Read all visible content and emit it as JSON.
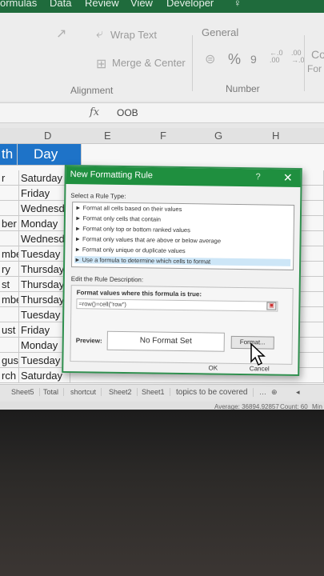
{
  "menubar": {
    "items": [
      "ormulas",
      "Data",
      "Review",
      "View",
      "Developer"
    ]
  },
  "ribbon": {
    "wrap_text": "Wrap Text",
    "merge_center": "Merge & Center",
    "number_format": "General",
    "percent": "%",
    "comma": "9",
    "inc_decimal": "←.0 .00",
    "dec_decimal": ".00 →.0",
    "conditional": "Co",
    "format_label": "For",
    "alignment_label": "Alignment",
    "number_label": "Number"
  },
  "formula_bar": {
    "fx": "fx",
    "value": "OOB"
  },
  "columns": [
    "D",
    "E",
    "F",
    "G",
    "H"
  ],
  "grid": {
    "header": [
      "th",
      "Day"
    ],
    "rows": [
      [
        "r",
        "Saturday"
      ],
      [
        "",
        "Friday"
      ],
      [
        "",
        "Wednesd"
      ],
      [
        "ber",
        "Monday"
      ],
      [
        "",
        "Wednesd"
      ],
      [
        "mber",
        "Tuesday"
      ],
      [
        "ry",
        "Thursday"
      ],
      [
        "st",
        "Thursday"
      ],
      [
        "mber",
        "Thursday"
      ],
      [
        "",
        "Tuesday"
      ],
      [
        "ust",
        "Friday"
      ],
      [
        "",
        "Monday"
      ],
      [
        "gust",
        "Tuesday"
      ],
      [
        "rch",
        "Saturday"
      ]
    ]
  },
  "dialog": {
    "title": "New Formatting Rule",
    "help": "?",
    "close": "✕",
    "select_label": "Select a Rule Type:",
    "rule_types": [
      "► Format all cells based on their values",
      "► Format only cells that contain",
      "► Format only top or bottom ranked values",
      "► Format only values that are above or below average",
      "► Format only unique or duplicate values",
      "► Use a formula to determine which cells to format"
    ],
    "edit_label": "Edit the Rule Description:",
    "formula_label": "Format values where this formula is true:",
    "formula_value": "=row()=cell(\"row\")",
    "preview_label": "Preview:",
    "preview_text": "No Format Set",
    "format_button": "Format...",
    "ok_button": "OK",
    "cancel_button": "Cancel"
  },
  "sheet_tabs": [
    "Sheet5",
    "Total",
    "shortcut",
    "Sheet2",
    "Sheet1",
    "topics to be covered"
  ],
  "status": {
    "average": "Average: 36894.92857",
    "count": "Count: 60",
    "min": "Min"
  },
  "colors": {
    "excel_green": "#1f8f3f",
    "header_blue": "#1e73c8"
  }
}
